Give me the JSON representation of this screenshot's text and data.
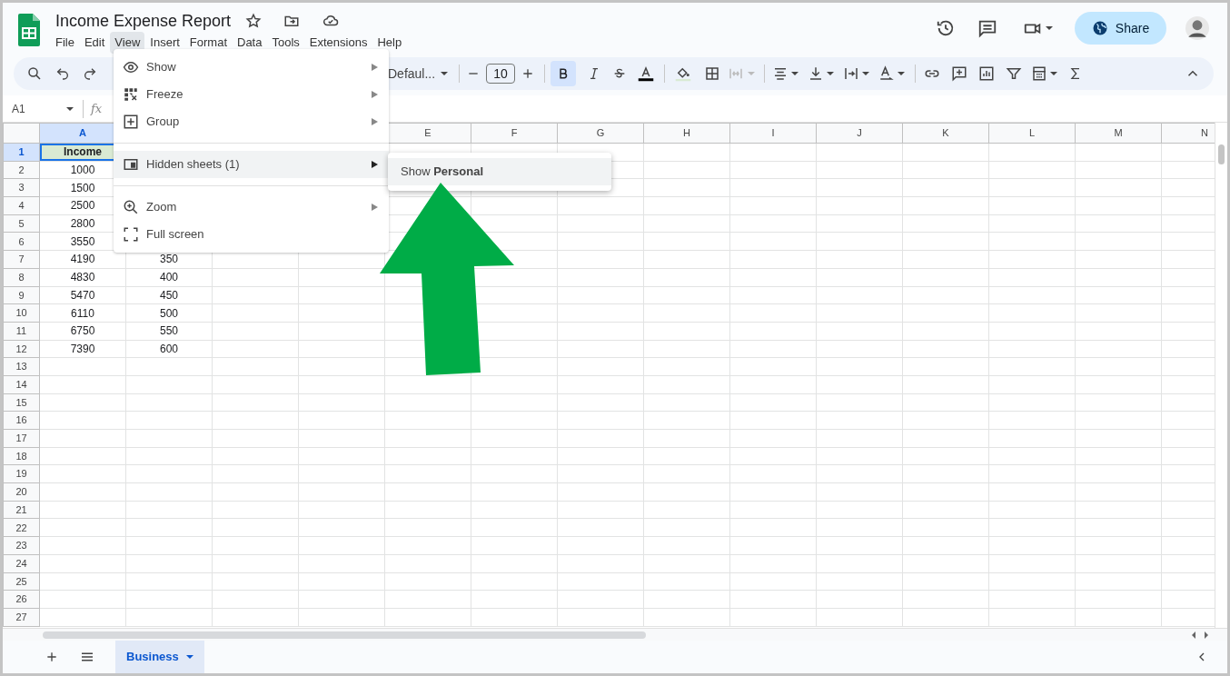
{
  "document": {
    "title": "Income Expense Report"
  },
  "menu_bar": [
    {
      "label": "File",
      "selected": false
    },
    {
      "label": "Edit",
      "selected": false
    },
    {
      "label": "View",
      "selected": true
    },
    {
      "label": "Insert",
      "selected": false
    },
    {
      "label": "Format",
      "selected": false
    },
    {
      "label": "Data",
      "selected": false
    },
    {
      "label": "Tools",
      "selected": false
    },
    {
      "label": "Extensions",
      "selected": false
    },
    {
      "label": "Help",
      "selected": false
    }
  ],
  "share_button": {
    "label": "Share"
  },
  "toolbar": {
    "font": "Defaul...",
    "font_size": "10",
    "bold_on": true,
    "merge_disabled": true
  },
  "formula_bar": {
    "cell_reference": "A1",
    "formula_label": "fx"
  },
  "grid": {
    "columns": [
      {
        "label": "A",
        "selected": true
      },
      {},
      {},
      {},
      {
        "label": "E",
        "selected": false
      },
      {
        "label": "F",
        "selected": false
      },
      {
        "label": "G",
        "selected": false
      },
      {
        "label": "H",
        "selected": false
      },
      {
        "label": "I",
        "selected": false
      },
      {
        "label": "J",
        "selected": false
      },
      {
        "label": "K",
        "selected": false
      },
      {
        "label": "L",
        "selected": false
      },
      {
        "label": "M",
        "selected": false
      },
      {
        "label": "N",
        "selected": false
      }
    ],
    "rows": [
      {
        "number": "1",
        "selected": true,
        "kind": "header",
        "cells": [
          "Income"
        ]
      },
      {
        "number": "2",
        "selected": false,
        "kind": "data",
        "cells": [
          "1000"
        ]
      },
      {
        "number": "3",
        "selected": false,
        "kind": "data",
        "cells": [
          "1500"
        ]
      },
      {
        "number": "4",
        "selected": false,
        "kind": "data",
        "cells": [
          "2500"
        ]
      },
      {
        "number": "5",
        "selected": false,
        "kind": "data",
        "cells": [
          "2800"
        ]
      },
      {
        "number": "6",
        "selected": false,
        "kind": "data",
        "cells": [
          "3550"
        ]
      },
      {
        "number": "7",
        "selected": false,
        "kind": "data",
        "cells": [
          "4190",
          "350"
        ]
      },
      {
        "number": "8",
        "selected": false,
        "kind": "data",
        "cells": [
          "4830",
          "400"
        ]
      },
      {
        "number": "9",
        "selected": false,
        "kind": "data",
        "cells": [
          "5470",
          "450"
        ]
      },
      {
        "number": "10",
        "selected": false,
        "kind": "data",
        "cells": [
          "6110",
          "500"
        ]
      },
      {
        "number": "11",
        "selected": false,
        "kind": "data",
        "cells": [
          "6750",
          "550"
        ]
      },
      {
        "number": "12",
        "selected": false,
        "kind": "data",
        "cells": [
          "7390",
          "600"
        ]
      },
      {
        "number": "13",
        "selected": false,
        "kind": "data",
        "cells": []
      },
      {
        "number": "14",
        "selected": false,
        "kind": "data",
        "cells": []
      },
      {
        "number": "15",
        "selected": false,
        "kind": "data",
        "cells": []
      },
      {
        "number": "16",
        "selected": false,
        "kind": "data",
        "cells": []
      },
      {
        "number": "17",
        "selected": false,
        "kind": "data",
        "cells": []
      },
      {
        "number": "18",
        "selected": false,
        "kind": "data",
        "cells": []
      },
      {
        "number": "19",
        "selected": false,
        "kind": "data",
        "cells": []
      },
      {
        "number": "20",
        "selected": false,
        "kind": "data",
        "cells": []
      },
      {
        "number": "21",
        "selected": false,
        "kind": "data",
        "cells": []
      },
      {
        "number": "22",
        "selected": false,
        "kind": "data",
        "cells": []
      },
      {
        "number": "23",
        "selected": false,
        "kind": "data",
        "cells": []
      },
      {
        "number": "24",
        "selected": false,
        "kind": "data",
        "cells": []
      },
      {
        "number": "25",
        "selected": false,
        "kind": "data",
        "cells": []
      },
      {
        "number": "26",
        "selected": false,
        "kind": "data",
        "cells": []
      },
      {
        "number": "27",
        "selected": false,
        "kind": "data",
        "cells": []
      }
    ]
  },
  "view_menu": {
    "items": [
      {
        "kind": "item",
        "label": "Show",
        "submenu": true,
        "highlighted": false
      },
      {
        "kind": "item",
        "label": "Freeze",
        "submenu": true,
        "highlighted": false
      },
      {
        "kind": "item",
        "label": "Group",
        "submenu": true,
        "highlighted": false
      },
      {
        "kind": "separator"
      },
      {
        "kind": "item",
        "label": "Hidden sheets (1)",
        "submenu": true,
        "highlighted": true
      },
      {
        "kind": "separator"
      },
      {
        "kind": "item",
        "label": "Zoom",
        "submenu": true,
        "highlighted": false
      },
      {
        "kind": "item",
        "label": "Full screen",
        "submenu": false,
        "highlighted": false
      }
    ]
  },
  "hidden_sheets_submenu": {
    "items": [
      {
        "label": "Show **Personal**",
        "highlighted": true
      }
    ]
  },
  "sheet_tabs": [
    {
      "label": "Business",
      "selected": true
    }
  ]
}
